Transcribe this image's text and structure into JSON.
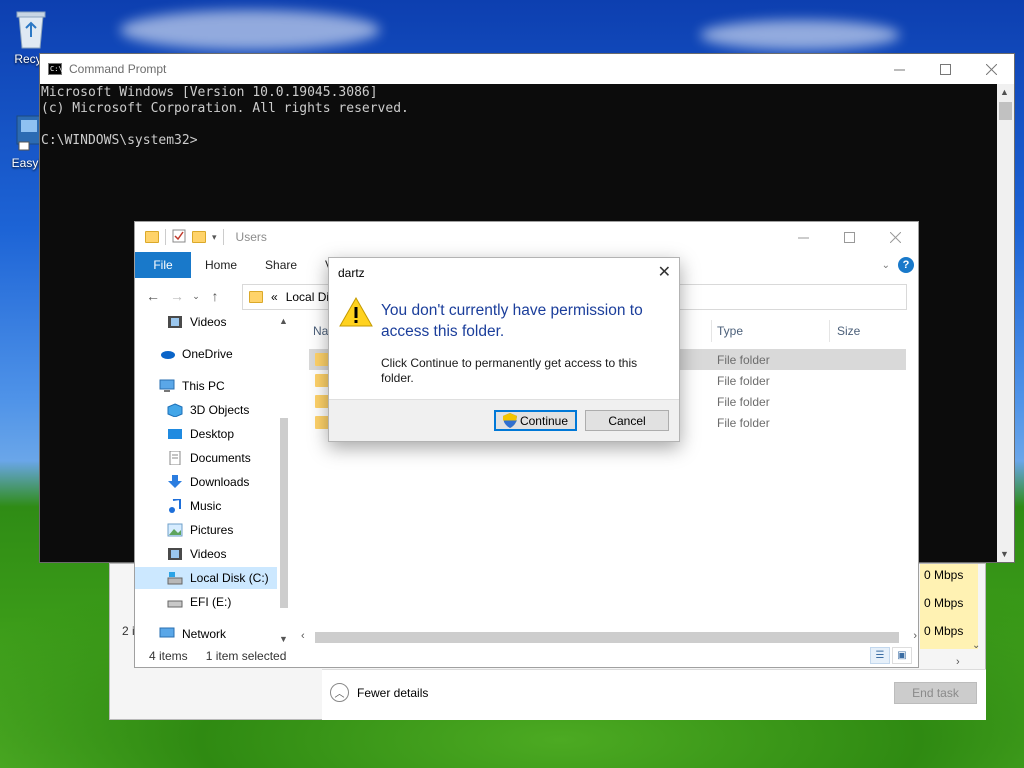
{
  "desktop": {
    "icons": [
      {
        "label": "Recyc"
      },
      {
        "label": "EasyB"
      }
    ]
  },
  "cmd": {
    "title": "Command Prompt",
    "lines": [
      "Microsoft Windows [Version 10.0.19045.3086]",
      "(c) Microsoft Corporation. All rights reserved.",
      "",
      "C:\\WINDOWS\\system32>"
    ]
  },
  "taskmgr": {
    "speeds": [
      "0 Mbps",
      "0 Mbps",
      "0 Mbps"
    ],
    "count_fragment": "2 i",
    "fewer_details": "Fewer details",
    "end_task": "End task"
  },
  "explorer": {
    "title": "Users",
    "ribbon_tabs": {
      "file": "File",
      "home": "Home",
      "share": "Share",
      "view_fragment": "V"
    },
    "address": {
      "prefix": "«",
      "path": "Local Dis"
    },
    "columns": {
      "name": "Na",
      "type": "Type",
      "size": "Size"
    },
    "rows": [
      {
        "type": "File folder",
        "selected": true
      },
      {
        "type": "File folder",
        "selected": false
      },
      {
        "type": "File folder",
        "selected": false
      },
      {
        "type": "File folder",
        "selected": false
      }
    ],
    "nav": [
      {
        "label": "Videos",
        "icon": "video-icon"
      },
      {
        "label": "OneDrive",
        "icon": "cloud-icon"
      },
      {
        "label": "This PC",
        "icon": "computer-icon"
      },
      {
        "label": "3D Objects",
        "icon": "cube-icon"
      },
      {
        "label": "Desktop",
        "icon": "desktop-icon"
      },
      {
        "label": "Documents",
        "icon": "document-icon"
      },
      {
        "label": "Downloads",
        "icon": "download-icon"
      },
      {
        "label": "Music",
        "icon": "music-icon"
      },
      {
        "label": "Pictures",
        "icon": "picture-icon"
      },
      {
        "label": "Videos",
        "icon": "video-icon"
      },
      {
        "label": "Local Disk (C:)",
        "icon": "drive-icon",
        "selected": true
      },
      {
        "label": "EFI (E:)",
        "icon": "drive-icon"
      },
      {
        "label": "Network",
        "icon": "network-icon"
      }
    ],
    "status": {
      "items": "4 items",
      "selected": "1 item selected"
    }
  },
  "dialog": {
    "title": "dartz",
    "heading": "You don't currently have permission to access this folder.",
    "body": "Click Continue to permanently get access to this folder.",
    "continue_label": "Continue",
    "cancel_label": "Cancel"
  }
}
